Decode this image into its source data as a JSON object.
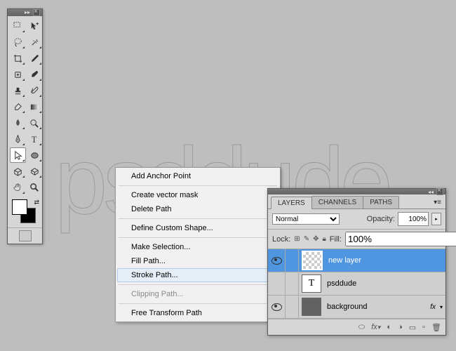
{
  "canvas_text": "psddude",
  "tools": {
    "swap": "⇄"
  },
  "context_menu": {
    "items": [
      {
        "label": "Add Anchor Point",
        "enabled": true
      },
      {
        "sep": true
      },
      {
        "label": "Create vector mask",
        "enabled": true
      },
      {
        "label": "Delete Path",
        "enabled": true
      },
      {
        "sep": true
      },
      {
        "label": "Define Custom Shape...",
        "enabled": true
      },
      {
        "sep": true
      },
      {
        "label": "Make Selection...",
        "enabled": true
      },
      {
        "label": "Fill Path...",
        "enabled": true
      },
      {
        "label": "Stroke Path...",
        "enabled": true,
        "hover": true
      },
      {
        "sep": true
      },
      {
        "label": "Clipping Path...",
        "enabled": false
      },
      {
        "sep": true
      },
      {
        "label": "Free Transform Path",
        "enabled": true
      }
    ]
  },
  "layers_panel": {
    "tabs": [
      "LAYERS",
      "CHANNELS",
      "PATHS"
    ],
    "blend_mode": "Normal",
    "opacity_label": "Opacity:",
    "opacity_value": "100%",
    "lock_label": "Lock:",
    "fill_label": "Fill:",
    "fill_value": "100%",
    "layers": [
      {
        "name": "new layer",
        "visible": true,
        "selected": true,
        "thumb": "checker"
      },
      {
        "name": "psddude",
        "visible": false,
        "thumb": "T"
      },
      {
        "name": "background",
        "visible": true,
        "thumb": "dark",
        "fx": true
      }
    ]
  }
}
